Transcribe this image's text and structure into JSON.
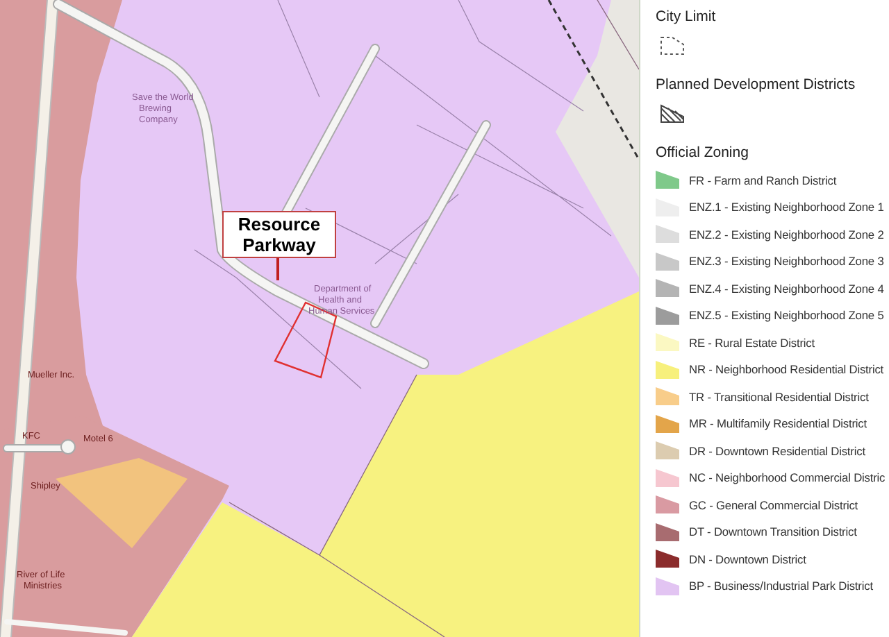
{
  "map": {
    "callout": [
      "Resource",
      "Parkway"
    ],
    "places": [
      {
        "name": "Save the World"
      },
      {
        "name": "Brewing"
      },
      {
        "name": "Company"
      },
      {
        "name": "Department of"
      },
      {
        "name": "Health and"
      },
      {
        "name": "Human Services"
      },
      {
        "name": "Mueller Inc."
      },
      {
        "name": "KFC"
      },
      {
        "name": "Motel 6"
      },
      {
        "name": "Shipley"
      },
      {
        "name": "River of Life"
      },
      {
        "name": "Ministries"
      }
    ]
  },
  "legend": {
    "sections": [
      {
        "title": "City Limit",
        "kind": "city-limit"
      },
      {
        "title": "Planned Development Districts",
        "kind": "planned"
      },
      {
        "title": "Official Zoning",
        "kind": "zoning",
        "items": [
          {
            "label": "FR - Farm and Ranch District",
            "color": "#7fc98a"
          },
          {
            "label": "ENZ.1 - Existing Neighborhood Zone 1",
            "color": "#eeeeee"
          },
          {
            "label": "ENZ.2 - Existing Neighborhood Zone 2",
            "color": "#dddddd"
          },
          {
            "label": "ENZ.3 - Existing Neighborhood Zone 3",
            "color": "#c8c8c8"
          },
          {
            "label": "ENZ.4 - Existing Neighborhood Zone 4",
            "color": "#b4b4b4"
          },
          {
            "label": "ENZ.5 - Existing Neighborhood Zone 5",
            "color": "#9c9c9c"
          },
          {
            "label": "RE - Rural Estate District",
            "color": "#fbf8c2"
          },
          {
            "label": "NR - Neighborhood Residential District",
            "color": "#f7f07c"
          },
          {
            "label": "TR - Transitional Residential District",
            "color": "#f8cd8a"
          },
          {
            "label": "MR - Multifamily Residential District",
            "color": "#e3a54a"
          },
          {
            "label": "DR - Downtown Residential District",
            "color": "#dcccb0"
          },
          {
            "label": "NC - Neighborhood Commercial Distric",
            "color": "#f6c7d0"
          },
          {
            "label": "GC - General Commercial District",
            "color": "#d99aa2"
          },
          {
            "label": "DT - Downtown Transition District",
            "color": "#a86c70"
          },
          {
            "label": "DN - Downtown District",
            "color": "#8b2c2c"
          },
          {
            "label": "BP - Business/Industrial Park District",
            "color": "#e2c4f2"
          }
        ]
      }
    ]
  }
}
